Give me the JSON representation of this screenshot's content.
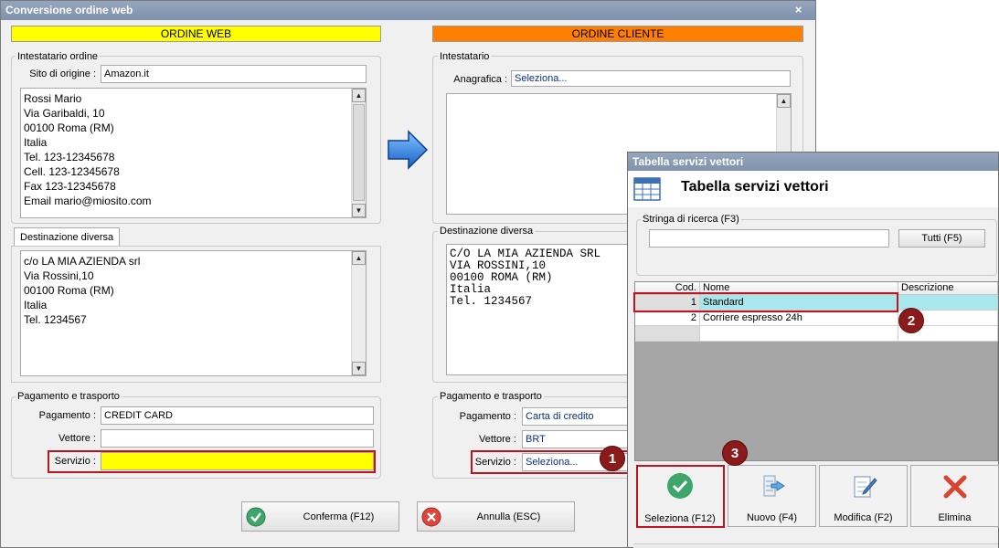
{
  "main_window": {
    "title": "Conversione ordine web",
    "close_glyph": "×",
    "web_header": "ORDINE WEB",
    "client_header": "ORDINE CLIENTE",
    "web": {
      "holder_group": "Intestatario ordine",
      "site_label": "Sito di origine :",
      "site_value": "Amazon.it",
      "address_lines": [
        "Rossi Mario",
        "Via Garibaldi, 10",
        "00100 Roma (RM)",
        "Italia",
        "Tel. 123-12345678",
        "Cell. 123-12345678",
        "Fax 123-12345678",
        "Email mario@miosito.com"
      ],
      "destination_tab": "Destinazione diversa",
      "destination_lines": [
        "c/o LA MIA AZIENDA srl",
        "Via Rossini,10",
        "00100 Roma (RM)",
        "Italia",
        "Tel. 1234567"
      ],
      "payment_group": "Pagamento e trasporto",
      "payment_label": "Pagamento :",
      "payment_value": "CREDIT CARD",
      "carrier_label": "Vettore :",
      "carrier_value": "",
      "service_label": "Servizio :",
      "service_value": ""
    },
    "client": {
      "holder_group": "Intestatario",
      "registry_label": "Anagrafica :",
      "registry_value": "Seleziona...",
      "destination_group": "Destinazione diversa",
      "destination_lines": [
        "C/O LA MIA AZIENDA SRL",
        "VIA ROSSINI,10",
        "00100 ROMA (RM)",
        "Italia",
        "Tel. 1234567"
      ],
      "payment_group": "Pagamento e trasporto",
      "payment_label": "Pagamento :",
      "payment_value": "Carta di credito",
      "carrier_label": "Vettore :",
      "carrier_value": "BRT",
      "service_label": "Servizio :",
      "service_value": "Seleziona..."
    },
    "confirm_button": "Conferma (F12)",
    "cancel_button": "Annulla (ESC)"
  },
  "dialog": {
    "title": "Tabella servizi vettori",
    "heading": "Tabella servizi vettori",
    "search_group": "Stringa di ricerca (F3)",
    "search_value": "",
    "all_button": "Tutti (F5)",
    "columns": [
      "Cod.",
      "Nome",
      "Descrizione"
    ],
    "rows": [
      {
        "code": "1",
        "name": "Standard",
        "description": ""
      },
      {
        "code": "2",
        "name": "Corriere espresso 24h",
        "description": ""
      }
    ],
    "select_button": "Seleziona (F12)",
    "new_button": "Nuovo (F4)",
    "edit_button": "Modifica (F2)",
    "delete_button": "Elimina"
  },
  "callouts": [
    "1",
    "2",
    "3"
  ],
  "colors": {
    "web_header_bg": "#ffff00",
    "client_header_bg": "#ff8000",
    "highlight_field": "#ffff00",
    "callout": "#8b1a1a",
    "selected_row": "#a8e8ec",
    "red_box": "#c1121f"
  }
}
